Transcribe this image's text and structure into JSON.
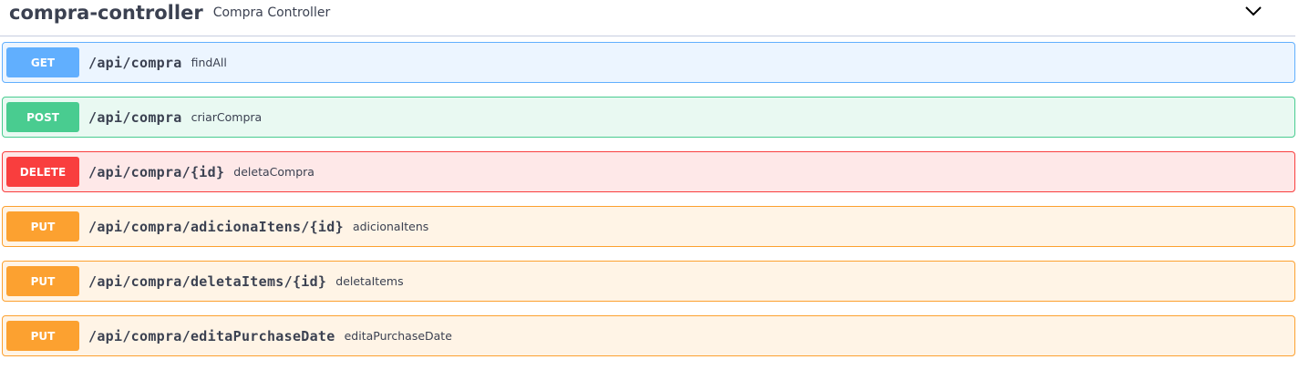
{
  "tag": {
    "name": "compra-controller",
    "description": "Compra Controller",
    "toggle_icon": "chevron-down-icon"
  },
  "colors": {
    "get": "#61affe",
    "post": "#49cc90",
    "delete": "#f93e3e",
    "put": "#fca130",
    "text": "#3b4151"
  },
  "operations": [
    {
      "method": "GET",
      "path": "/api/compra",
      "summary": "findAll"
    },
    {
      "method": "POST",
      "path": "/api/compra",
      "summary": "criarCompra"
    },
    {
      "method": "DELETE",
      "path": "/api/compra/{id}",
      "summary": "deletaCompra"
    },
    {
      "method": "PUT",
      "path": "/api/compra/adicionaItens/{id}",
      "summary": "adicionaItens"
    },
    {
      "method": "PUT",
      "path": "/api/compra/deletaItems/{id}",
      "summary": "deletaItems"
    },
    {
      "method": "PUT",
      "path": "/api/compra/editaPurchaseDate",
      "summary": "editaPurchaseDate"
    }
  ]
}
